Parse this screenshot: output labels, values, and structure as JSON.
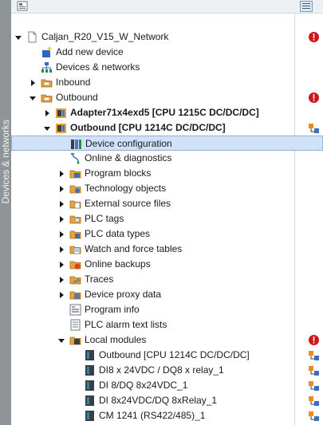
{
  "sidebar": {
    "title": "Devices & networks"
  },
  "tree": [
    {
      "label": "Caljan_R20_V15_W_Network",
      "level": 0,
      "expander": "expanded",
      "icon": "project-icon",
      "status": "error"
    },
    {
      "label": "Add new device",
      "level": 1,
      "expander": "none",
      "icon": "add-device-icon",
      "status": ""
    },
    {
      "label": "Devices & networks",
      "level": 1,
      "expander": "none",
      "icon": "network-icon",
      "status": ""
    },
    {
      "label": "Inbound",
      "level": 1,
      "expander": "collapsed",
      "icon": "group-folder-icon",
      "status": ""
    },
    {
      "label": "Outbound",
      "level": 1,
      "expander": "expanded",
      "icon": "group-folder-icon",
      "status": "error"
    },
    {
      "label": "Adapter71x4exd5 [CPU 1215C DC/DC/DC]",
      "level": 2,
      "expander": "collapsed",
      "icon": "plc-icon",
      "status": "",
      "bold": true
    },
    {
      "label": "Outbound [CPU 1214C DC/DC/DC]",
      "level": 2,
      "expander": "expanded",
      "icon": "plc-icon",
      "status": "compare",
      "bold": true
    },
    {
      "label": "Device configuration",
      "level": 3,
      "expander": "none",
      "icon": "device-config-icon",
      "status": "",
      "selected": true
    },
    {
      "label": "Online & diagnostics",
      "level": 3,
      "expander": "none",
      "icon": "diagnostics-icon",
      "status": ""
    },
    {
      "label": "Program blocks",
      "level": 3,
      "expander": "collapsed",
      "icon": "program-blocks-folder-icon",
      "status": ""
    },
    {
      "label": "Technology objects",
      "level": 3,
      "expander": "collapsed",
      "icon": "technology-folder-icon",
      "status": ""
    },
    {
      "label": "External source files",
      "level": 3,
      "expander": "collapsed",
      "icon": "external-source-folder-icon",
      "status": ""
    },
    {
      "label": "PLC tags",
      "level": 3,
      "expander": "collapsed",
      "icon": "plc-tags-folder-icon",
      "status": ""
    },
    {
      "label": "PLC data types",
      "level": 3,
      "expander": "collapsed",
      "icon": "plc-data-types-folder-icon",
      "status": ""
    },
    {
      "label": "Watch and force tables",
      "level": 3,
      "expander": "collapsed",
      "icon": "watch-table-folder-icon",
      "status": ""
    },
    {
      "label": "Online backups",
      "level": 3,
      "expander": "collapsed",
      "icon": "online-backup-folder-icon",
      "status": ""
    },
    {
      "label": "Traces",
      "level": 3,
      "expander": "collapsed",
      "icon": "traces-folder-icon",
      "status": ""
    },
    {
      "label": "Device proxy data",
      "level": 3,
      "expander": "collapsed",
      "icon": "device-proxy-folder-icon",
      "status": ""
    },
    {
      "label": "Program info",
      "level": 3,
      "expander": "none",
      "icon": "program-info-icon",
      "status": ""
    },
    {
      "label": "PLC alarm text lists",
      "level": 3,
      "expander": "none",
      "icon": "alarm-text-list-icon",
      "status": ""
    },
    {
      "label": "Local modules",
      "level": 3,
      "expander": "expanded",
      "icon": "local-modules-folder-icon",
      "status": "error"
    },
    {
      "label": "Outbound [CPU 1214C DC/DC/DC]",
      "level": 4,
      "expander": "none",
      "icon": "module-icon",
      "status": "compare"
    },
    {
      "label": "DI8 x 24VDC / DQ8 x relay_1",
      "level": 4,
      "expander": "none",
      "icon": "module-icon",
      "status": "compare"
    },
    {
      "label": "DI 8/DQ 8x24VDC_1",
      "level": 4,
      "expander": "none",
      "icon": "module-icon",
      "status": "compare"
    },
    {
      "label": "DI 8x24VDC/DQ 8xRelay_1",
      "level": 4,
      "expander": "none",
      "icon": "module-icon",
      "status": "compare"
    },
    {
      "label": "CM 1241 (RS422/485)_1",
      "level": 4,
      "expander": "none",
      "icon": "module-icon",
      "status": "compare"
    }
  ],
  "colors": {
    "accent": "#e8a23a",
    "error": "#d4151b",
    "selection": "#cfe2f8"
  }
}
